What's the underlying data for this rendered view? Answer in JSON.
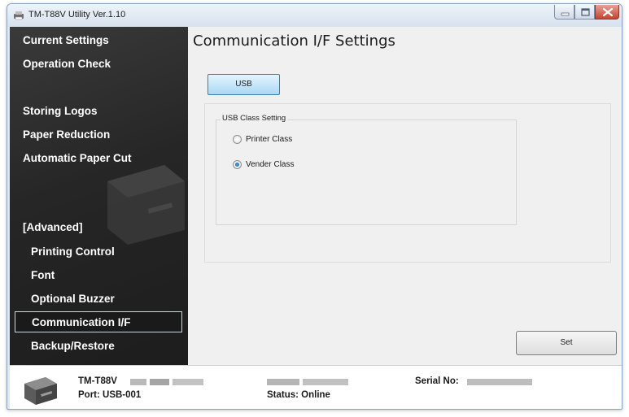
{
  "window": {
    "title": "TM-T88V Utility Ver.1.10"
  },
  "sidebar": {
    "items": [
      {
        "label": "Current Settings"
      },
      {
        "label": "Operation Check"
      },
      {
        "label": "Storing Logos"
      },
      {
        "label": "Paper Reduction"
      },
      {
        "label": "Automatic Paper Cut"
      },
      {
        "label": "[Advanced]"
      },
      {
        "label": "Printing Control"
      },
      {
        "label": "Font"
      },
      {
        "label": "Optional Buzzer"
      },
      {
        "label": "Communication I/F",
        "selected": true
      },
      {
        "label": "Backup/Restore"
      }
    ]
  },
  "main": {
    "title": "Communication I/F Settings",
    "tab_label": "USB",
    "group_title": "USB Class Setting",
    "radio_options": [
      {
        "label": "Printer Class",
        "checked": false
      },
      {
        "label": "Vender Class",
        "checked": true
      }
    ],
    "set_button": "Set"
  },
  "status": {
    "model": "TM-T88V",
    "port": "Port: USB-001",
    "status_text": "Status: Online",
    "serial_label": "Serial No:"
  },
  "colors": {
    "sidebar_bg": "#262626",
    "tab_accent": "#a9d8f5",
    "radio_selected": "#1f5c9b",
    "close_button": "#c7432f"
  },
  "icons": [
    "app-printer-icon",
    "minimize-icon",
    "maximize-icon",
    "close-icon",
    "printer-icon"
  ]
}
